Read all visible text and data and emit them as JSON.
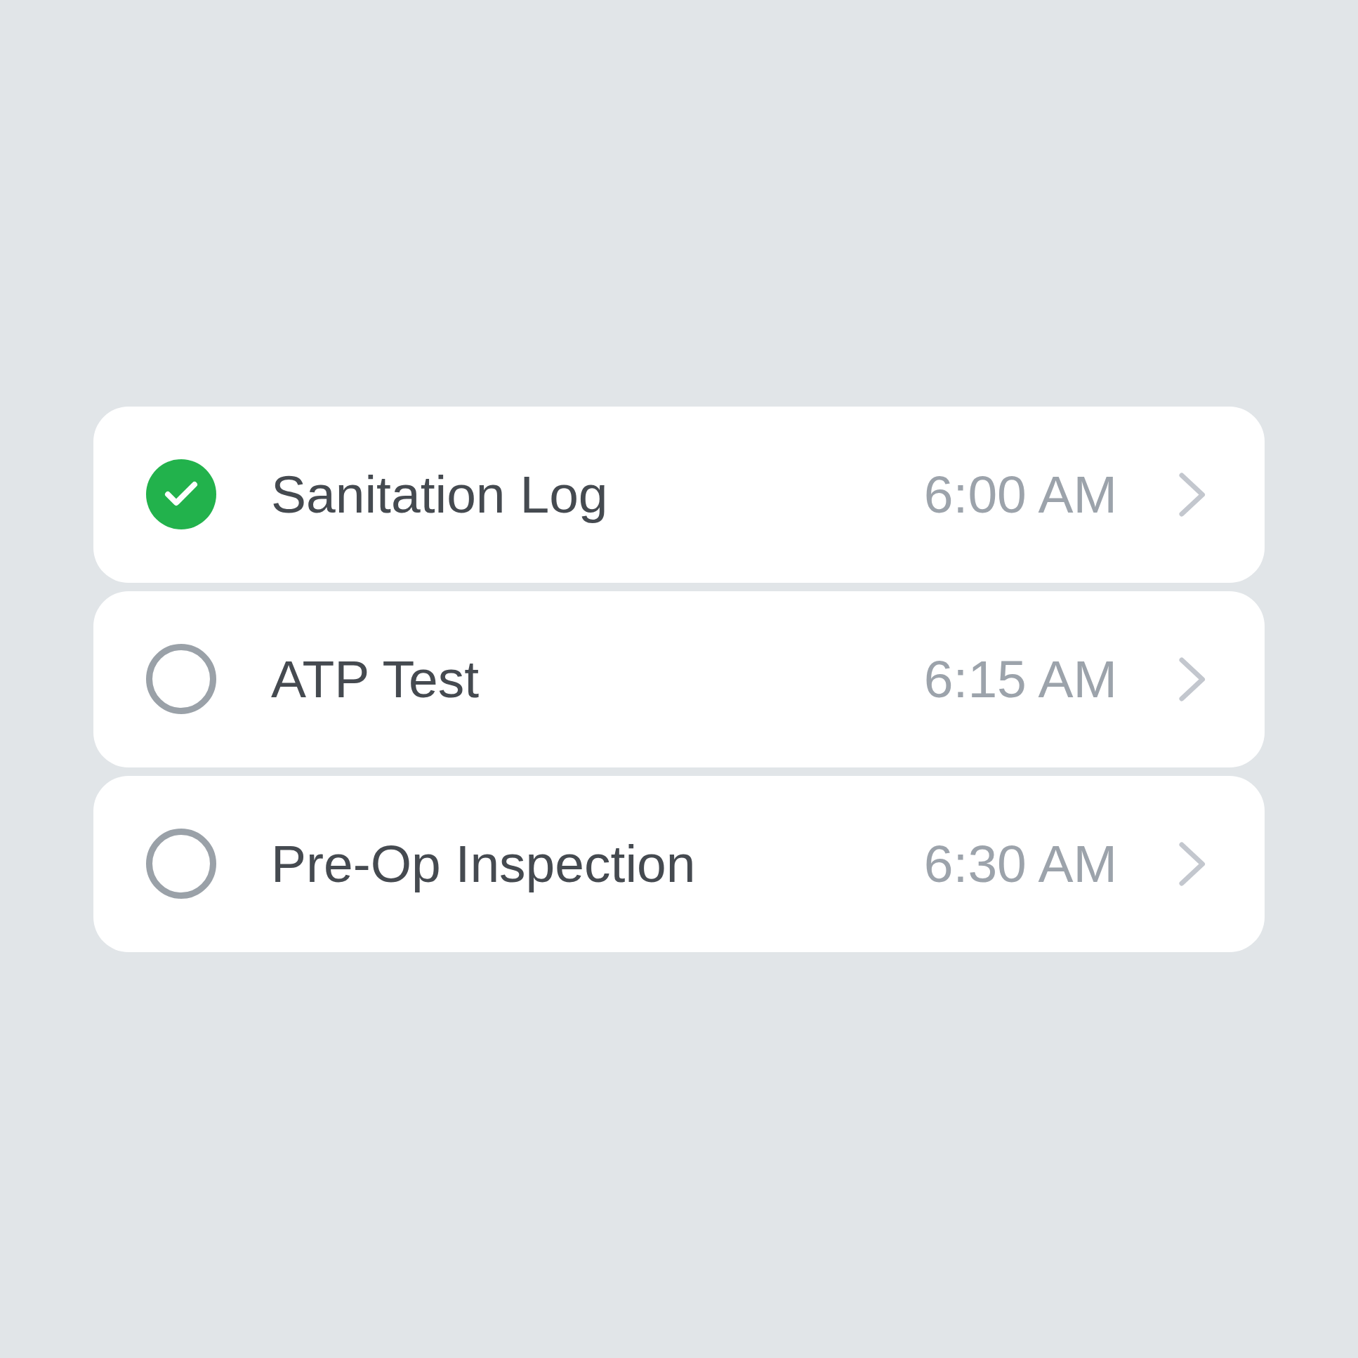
{
  "tasks": [
    {
      "title": "Sanitation Log",
      "time": "6:00 AM",
      "checked": true
    },
    {
      "title": "ATP Test",
      "time": "6:15 AM",
      "checked": false
    },
    {
      "title": "Pre-Op Inspection",
      "time": "6:30 AM",
      "checked": false
    }
  ]
}
